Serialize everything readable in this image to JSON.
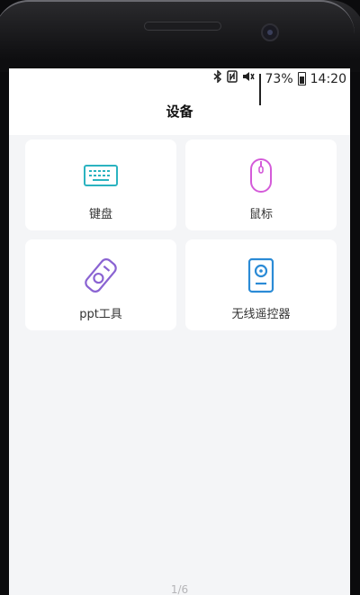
{
  "status": {
    "battery_percent": "73%",
    "time": "14:20",
    "bluetooth_icon": "bluetooth-icon",
    "nfc_icon": "nfc-icon",
    "mute_icon": "mute-icon",
    "signal_icon": "signal-icon",
    "battery_icon": "battery-icon"
  },
  "header": {
    "title": "设备"
  },
  "devices": [
    {
      "label": "键盘",
      "icon": "keyboard-icon",
      "color": "#2bb3c0"
    },
    {
      "label": "鼠标",
      "icon": "mouse-icon",
      "color": "#d45bd9"
    },
    {
      "label": "ppt工具",
      "icon": "presenter-icon",
      "color": "#8a63d2"
    },
    {
      "label": "无线遥控器",
      "icon": "remote-icon",
      "color": "#2b8bd6"
    }
  ],
  "pager": {
    "text": "1/6"
  },
  "colors": {
    "background": "#f4f5f7",
    "card": "#ffffff"
  }
}
